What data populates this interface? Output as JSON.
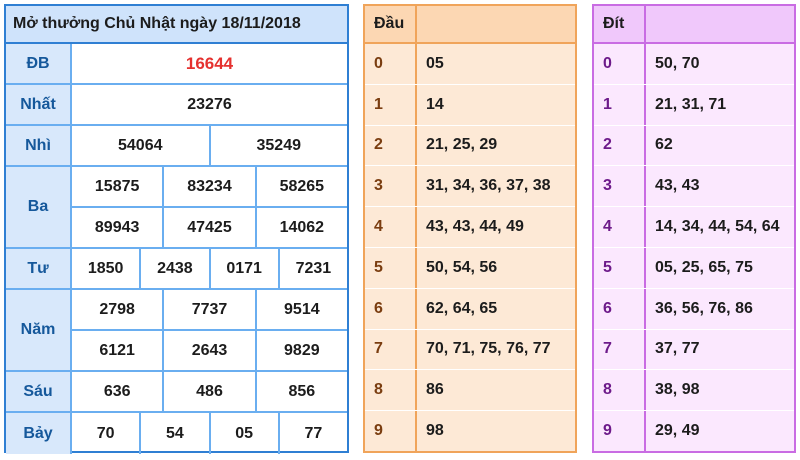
{
  "results": {
    "title": "Mở thưởng Chủ Nhật ngày 18/11/2018",
    "prizes": [
      {
        "label": "ĐB",
        "lines": [
          [
            "16644"
          ]
        ],
        "special": true
      },
      {
        "label": "Nhất",
        "lines": [
          [
            "23276"
          ]
        ]
      },
      {
        "label": "Nhì",
        "lines": [
          [
            "54064",
            "35249"
          ]
        ]
      },
      {
        "label": "Ba",
        "lines": [
          [
            "15875",
            "83234",
            "58265"
          ],
          [
            "89943",
            "47425",
            "14062"
          ]
        ]
      },
      {
        "label": "Tư",
        "lines": [
          [
            "1850",
            "2438",
            "0171",
            "7231"
          ]
        ]
      },
      {
        "label": "Năm",
        "lines": [
          [
            "2798",
            "7737",
            "9514"
          ],
          [
            "6121",
            "2643",
            "9829"
          ]
        ]
      },
      {
        "label": "Sáu",
        "lines": [
          [
            "636",
            "486",
            "856"
          ]
        ]
      },
      {
        "label": "Bảy",
        "lines": [
          [
            "70",
            "54",
            "05",
            "77"
          ]
        ]
      }
    ]
  },
  "dau": {
    "header": "Đầu",
    "rows": [
      {
        "key": "0",
        "value": "05"
      },
      {
        "key": "1",
        "value": "14"
      },
      {
        "key": "2",
        "value": "21, 25, 29"
      },
      {
        "key": "3",
        "value": "31, 34, 36, 37, 38"
      },
      {
        "key": "4",
        "value": "43, 43, 44, 49"
      },
      {
        "key": "5",
        "value": "50, 54, 56"
      },
      {
        "key": "6",
        "value": "62, 64, 65"
      },
      {
        "key": "7",
        "value": "70, 71, 75, 76, 77"
      },
      {
        "key": "8",
        "value": "86"
      },
      {
        "key": "9",
        "value": "98"
      }
    ]
  },
  "dit": {
    "header": "Đít",
    "rows": [
      {
        "key": "0",
        "value": "50, 70"
      },
      {
        "key": "1",
        "value": "21, 31, 71"
      },
      {
        "key": "2",
        "value": "62"
      },
      {
        "key": "3",
        "value": "43, 43"
      },
      {
        "key": "4",
        "value": "14, 34, 44, 54, 64"
      },
      {
        "key": "5",
        "value": "05, 25, 65, 75"
      },
      {
        "key": "6",
        "value": "36, 56, 76, 86"
      },
      {
        "key": "7",
        "value": "37, 77"
      },
      {
        "key": "8",
        "value": "38, 98"
      },
      {
        "key": "9",
        "value": "29, 49"
      }
    ]
  },
  "colors": {
    "results_accent": "#2f7fd3",
    "special_prize": "#e5312f",
    "dau_accent": "#f0a45a",
    "dit_accent": "#c96ce3"
  }
}
